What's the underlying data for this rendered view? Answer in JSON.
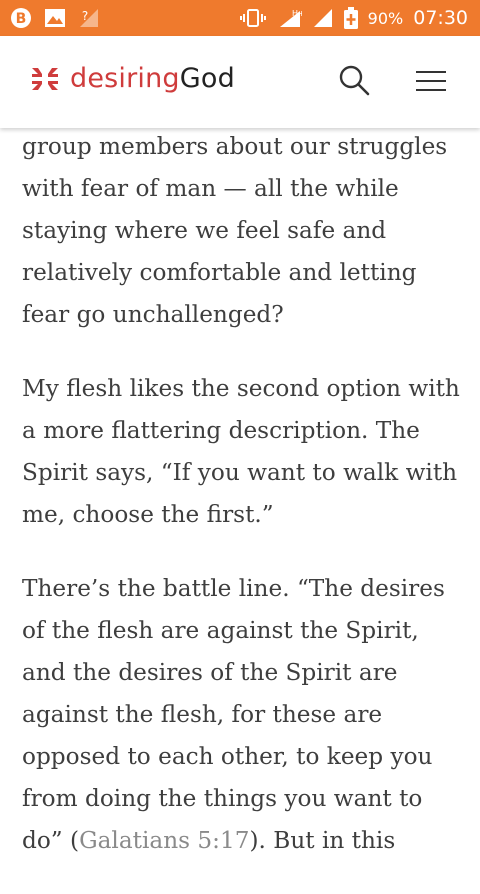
{
  "status_bar": {
    "battery_percent": "90%",
    "time": "07:30",
    "icons": [
      "b-notification-icon",
      "gallery-icon",
      "signal-question-icon",
      "vibrate-icon",
      "signal-h-plus-icon",
      "signal-icon",
      "battery-charging-icon"
    ],
    "network_label": "H+"
  },
  "header": {
    "brand_part1": "desiring",
    "brand_part2": "God",
    "brand_color": "#cf3c3c",
    "accent_color": "#ef7a2d"
  },
  "article": {
    "p1": "group members about our struggles with fear of man — all the while staying where we feel safe and relatively comfortable and letting fear go unchallenged?",
    "p2": "My flesh likes the second option with a more flattering description. The Spirit says, “If you want to walk with me, choose the first.”",
    "p3_before": "There’s the battle line. “The desires of the flesh are against the Spirit, and the desires of the Spirit are against the flesh, for these are opposed to each other, to keep you from doing the things you want to do” (",
    "p3_link": "Galatians 5:17",
    "p3_after": "). But in this"
  }
}
